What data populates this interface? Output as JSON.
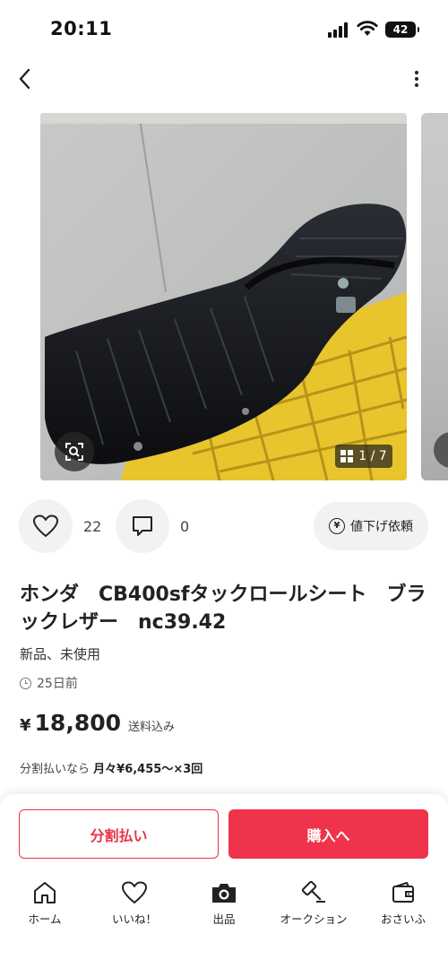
{
  "status_bar": {
    "time": "20:11",
    "battery": "42"
  },
  "photos": {
    "counter": "1 / 7",
    "current": 1,
    "total": 7
  },
  "actions": {
    "like_count": "22",
    "comment_count": "0",
    "price_request_label": "値下げ依頼"
  },
  "item": {
    "title": "ホンダ　CB400sfタックロールシート　ブラックレザー　nc39.42",
    "condition": "新品、未使用",
    "posted": "25日前",
    "price_symbol": "¥",
    "price": "18,800",
    "shipping": "送料込み",
    "installment_prefix": "分割払いなら",
    "installment_detail": "月々¥6,455～×3回"
  },
  "buttons": {
    "installment": "分割払い",
    "purchase": "購入へ"
  },
  "tabs": [
    {
      "label": "ホーム",
      "icon": "home-icon"
    },
    {
      "label": "いいね！",
      "icon": "heart-icon"
    },
    {
      "label": "出品",
      "icon": "camera-icon"
    },
    {
      "label": "オークション",
      "icon": "gavel-icon"
    },
    {
      "label": "おさいふ",
      "icon": "wallet-icon"
    }
  ],
  "colors": {
    "accent": "#f0334c",
    "seat": "#16181c",
    "crate": "#e8c52c"
  }
}
